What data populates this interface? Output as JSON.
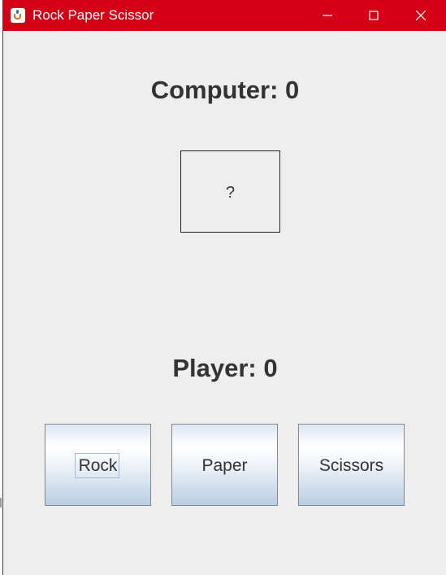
{
  "window": {
    "title": "Rock Paper Scissor",
    "app_icon": "java-cup-icon",
    "controls": [
      "minimize-icon",
      "maximize-icon",
      "close-icon"
    ],
    "titlebar_color": "#d40016"
  },
  "game": {
    "computer_score_label": "Computer: 0",
    "computer_choice": "?",
    "player_score_label": "Player: 0"
  },
  "buttons": {
    "rock": "Rock",
    "paper": "Paper",
    "scissors": "Scissors"
  }
}
